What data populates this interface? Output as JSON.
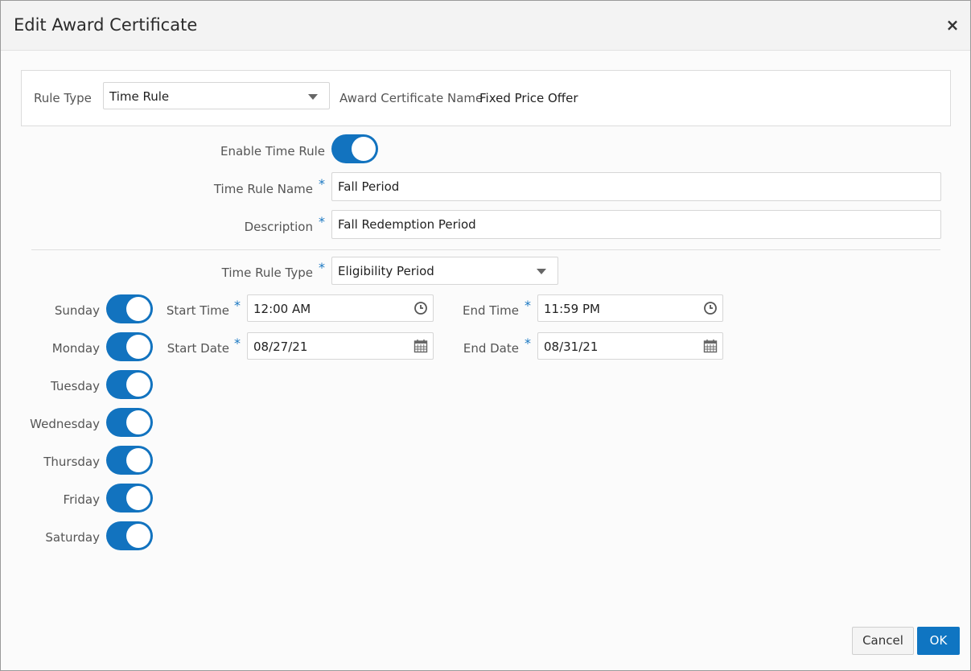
{
  "dialog": {
    "title": "Edit Award Certificate",
    "close_glyph": "×"
  },
  "header_panel": {
    "rule_type_label": "Rule Type",
    "rule_type_value": "Time Rule",
    "cert_name_label": "Award Certificate Name",
    "cert_name_value": "Fixed Price Offer"
  },
  "form": {
    "enable_label": "Enable Time Rule",
    "enable_on": true,
    "name_label": "Time Rule Name",
    "name_value": "Fall Period",
    "desc_label": "Description",
    "desc_value": "Fall Redemption Period",
    "type_label": "Time Rule Type",
    "type_value": "Eligibility Period",
    "required_mark": "*"
  },
  "days": [
    {
      "label": "Sunday",
      "on": true
    },
    {
      "label": "Monday",
      "on": true
    },
    {
      "label": "Tuesday",
      "on": true
    },
    {
      "label": "Wednesday",
      "on": true
    },
    {
      "label": "Thursday",
      "on": true
    },
    {
      "label": "Friday",
      "on": true
    },
    {
      "label": "Saturday",
      "on": true
    }
  ],
  "schedule": {
    "start_time_label": "Start Time",
    "start_time_value": "12:00 AM",
    "end_time_label": "End Time",
    "end_time_value": "11:59 PM",
    "start_date_label": "Start Date",
    "start_date_value": "08/27/21",
    "end_date_label": "End Date",
    "end_date_value": "08/31/21"
  },
  "footer": {
    "cancel_label": "Cancel",
    "ok_label": "OK"
  },
  "colors": {
    "accent": "#1273bf",
    "required": "#1a78c2"
  },
  "icons": {
    "close": "close-icon",
    "dropdown": "chevron-down-icon",
    "time": "clock-icon",
    "date": "calendar-icon"
  }
}
